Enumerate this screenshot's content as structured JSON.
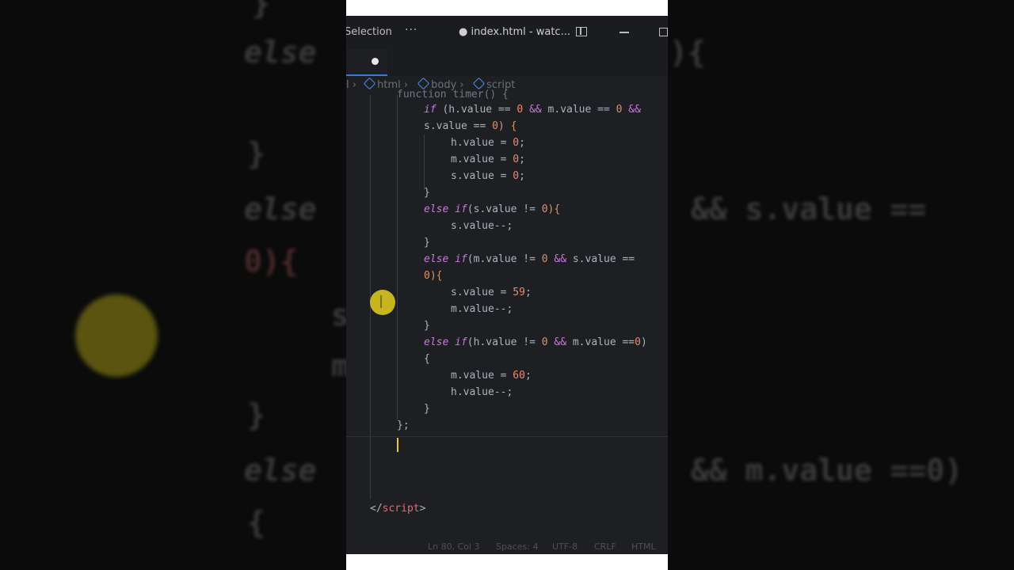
{
  "titlebar": {
    "menu_selection": "Selection",
    "menu_more": "···",
    "window_title": "● index.html - watc..."
  },
  "breadcrumb": [
    "html",
    "body",
    "script"
  ],
  "code": {
    "line_0": "function timer() {",
    "if_1": "if",
    "if_1_rest_a": " (h.value == ",
    "zero": "0",
    "amp": "&&",
    "if_1_rest_b": " m.value == ",
    "if_1_rest_c": "s.value == ",
    "if_1_rest_d": ") {",
    "h_assign": "h.value = ",
    "m_assign": "m.value = ",
    "s_assign": "s.value = ",
    "semi": ";",
    "close_brace": "}",
    "else": "else",
    "if": "if",
    "elseif_1_rest": "(s.value != ",
    "elseif_close": "){",
    "s_dec": "s.value--;",
    "elseif_2_rest_a": "(m.value != ",
    "elseif_2_rest_b": " s.value ==",
    "elseif_2_cont": "){",
    "fifty_nine": "59",
    "m_dec": "m.value--;",
    "elseif_3_rest_a": "(h.value != ",
    "elseif_3_rest_b": " m.value ==",
    "elseif_3_rest_c": ")",
    "open_brace": "{",
    "sixty": "60",
    "h_dec": "h.value--;",
    "end_fn": "};",
    "script_close_a": "</",
    "script_close_tag": "script",
    "script_close_b": ">"
  },
  "status": {
    "position": "Ln 80, Col 3",
    "spaces": "Spaces: 4",
    "encoding": "UTF-8",
    "eol": "CRLF",
    "language": "HTML"
  },
  "background": {
    "else_1": "else",
    "else_2": "else",
    "else_3": "else",
    "brace_1": "}",
    "brace_2": "}",
    "brace_3": "{",
    "zero_brace": "0){",
    "right_1": "){",
    "right_2": "&& s.value ==",
    "right_3": "&& m.value ==0)",
    "partial_s": "s",
    "partial_m": "m"
  }
}
